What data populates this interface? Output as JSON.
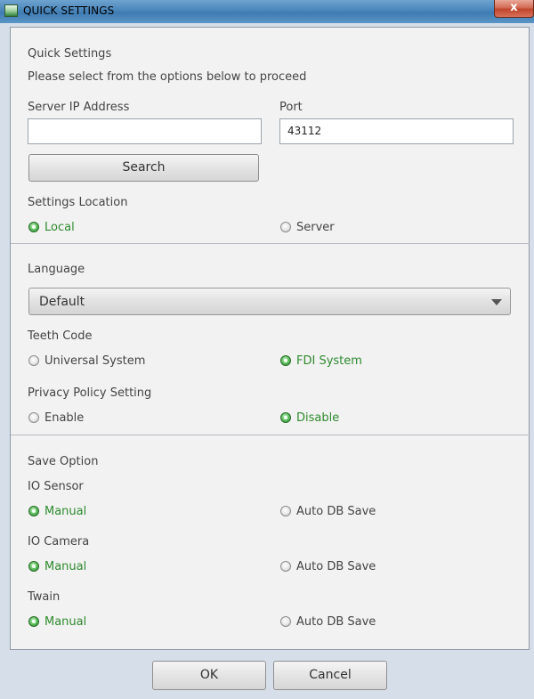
{
  "window": {
    "title": "QUICK SETTINGS",
    "close_glyph": "x"
  },
  "header": {
    "title": "Quick Settings",
    "subtitle": "Please select from the options below to proceed"
  },
  "server": {
    "ip_label": "Server IP Address",
    "ip_value": "",
    "port_label": "Port",
    "port_value": "43112",
    "search_label": "Search"
  },
  "settings_location": {
    "label": "Settings Location",
    "options": [
      {
        "label": "Local",
        "selected": true
      },
      {
        "label": "Server",
        "selected": false
      }
    ]
  },
  "language": {
    "label": "Language",
    "selected": "Default"
  },
  "teeth_code": {
    "label": "Teeth Code",
    "options": [
      {
        "label": "Universal System",
        "selected": false
      },
      {
        "label": "FDI System",
        "selected": true
      }
    ]
  },
  "privacy": {
    "label": "Privacy Policy Setting",
    "options": [
      {
        "label": "Enable",
        "selected": false
      },
      {
        "label": "Disable",
        "selected": true
      }
    ]
  },
  "save_option": {
    "label": "Save Option",
    "io_sensor": {
      "label": "IO Sensor",
      "options": [
        {
          "label": "Manual",
          "selected": true
        },
        {
          "label": "Auto DB Save",
          "selected": false
        }
      ]
    },
    "io_camera": {
      "label": "IO Camera",
      "options": [
        {
          "label": "Manual",
          "selected": true
        },
        {
          "label": "Auto DB Save",
          "selected": false
        }
      ]
    },
    "twain": {
      "label": "Twain",
      "options": [
        {
          "label": "Manual",
          "selected": true
        },
        {
          "label": "Auto DB Save",
          "selected": false
        }
      ]
    }
  },
  "footer": {
    "ok_label": "OK",
    "cancel_label": "Cancel"
  },
  "colors": {
    "selected_text": "#2e8b2e",
    "radio_selected": "#3fa33f"
  }
}
